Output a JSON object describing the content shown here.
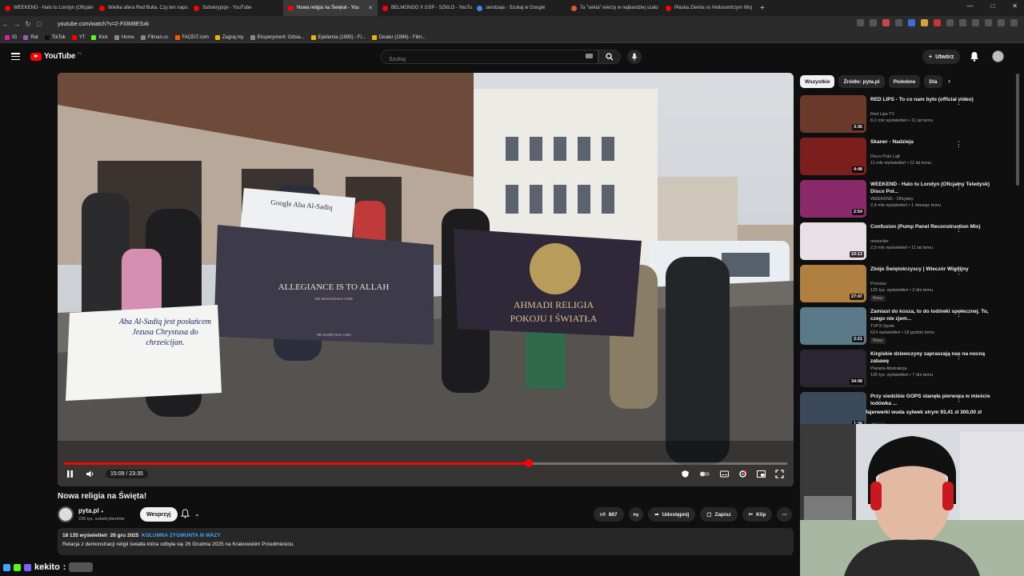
{
  "browser": {
    "tabs": [
      {
        "label": "WEEKEND - Halo tu Londyn (Oficjaln",
        "color": "#ff0000",
        "active": false
      },
      {
        "label": "Wielka afera Red Bulla. Czy ten napo",
        "color": "#ff0000",
        "active": false
      },
      {
        "label": "Subskrypcje - YouTube",
        "color": "#ff0000",
        "active": false
      },
      {
        "label": "Nowa religia na Świętal - You",
        "color": "#ff0000",
        "active": true
      },
      {
        "label": "BELMONDO X GSP - SZKŁO - YouTub",
        "color": "#ff0000",
        "active": false
      },
      {
        "label": "sendzaja - Szukaj w Google",
        "color": "#4285f4",
        "active": false
      },
      {
        "label": "Ta \"sekta\" wierzy w najbardziej szalo",
        "color": "#e2582c",
        "active": false
      },
      {
        "label": "Płaska Ziemia vs Heliocentrzym Woj",
        "color": "#ff0000",
        "active": false
      }
    ],
    "new_tab": "+",
    "url": "youtube.com/watch?v=2-FI0M8ESxk",
    "bookmarks": [
      {
        "label": "IG",
        "color": "#d6249f"
      },
      {
        "label": "Rat",
        "color": "#9b59b6"
      },
      {
        "label": "TikTok",
        "color": "#111111"
      },
      {
        "label": "YT",
        "color": "#ff0000"
      },
      {
        "label": "Kick",
        "color": "#53fc18"
      },
      {
        "label": "Home",
        "color": "#888888"
      },
      {
        "label": "Filman.cc",
        "color": "#888888"
      },
      {
        "label": "FACEIT.com",
        "color": "#ff5500"
      },
      {
        "label": "Zagraj.my",
        "color": "#e8b400"
      },
      {
        "label": "Eksperyment: Odsia...",
        "color": "#888888"
      },
      {
        "label": "Epidemia (1995) - Fi...",
        "color": "#e8b400"
      },
      {
        "label": "Dealer (1996) - Film...",
        "color": "#e8b400"
      }
    ]
  },
  "header": {
    "logo": "YouTube",
    "country": "PL",
    "search_placeholder": "Szukaj",
    "create_label": "Utwórz"
  },
  "player": {
    "time_current": "15:09",
    "time_total": "23:35",
    "time_text": "15:09 / 23:35",
    "progress": 0.643,
    "banners": {
      "google": "Google Aba Al-Sadiq",
      "allegiance": "ALLEGIANCE IS TO ALLAH",
      "allegiance_small": "THE MASSIAH HAS COME",
      "allegiance_bottom": "THE MAHDI HAS COME",
      "ahmadi_line1": "AHMADI RELIGIA",
      "ahmadi_line2": "POKOJU I ŚWIATŁA",
      "sign": "Aba Al-Sadiq jest posłańcem Jezusa Chrystusa do chrześcijan."
    }
  },
  "video": {
    "title": "Nowa religia na Święta!",
    "channel": "pyta.pl",
    "subscribers": "235 tys. subskrybentów",
    "support_label": "Wesprzyj",
    "likes": "887",
    "share_label": "Udostępnij",
    "save_label": "Zapisz",
    "clip_label": "Klip",
    "views": "18 135 wyświetleń",
    "date": "26 gru 2025",
    "location_tag": "KOLUMNA ZYGMUNTA III WAZY",
    "description": "Relacja z demonstracji religii światła która odbyła się 26 Grudnia 2025 na Krakowskim Przedmieściu."
  },
  "sidebar": {
    "chips": [
      {
        "label": "Wszystkie",
        "active": true
      },
      {
        "label": "Źródło: pyta.pl",
        "active": false
      },
      {
        "label": "Podobne",
        "active": false
      },
      {
        "label": "Dla",
        "active": false
      }
    ],
    "items": [
      {
        "title": "RED LIPS - To co nam było (official video)",
        "channel": "Red Lips TV",
        "meta": "8,2 mln wyświetleń • 11 lat temu",
        "duration": "3:36",
        "badge": "",
        "bg": "#6b3a2a"
      },
      {
        "title": "Skaner - Nadzieja",
        "channel": "Disco Polo Lajf",
        "meta": "11 mln wyświetleń • 11 lat temu",
        "duration": "4:48",
        "badge": "",
        "bg": "#7a1e1e"
      },
      {
        "title": "WEEKEND - Halo tu Londyn (Oficjalny Teledysk) Disco Pol...",
        "channel": "WEEKEND - Oficjalny",
        "meta": "2,4 mln wyświetleń • 1 miesiąc temu",
        "duration": "2:54",
        "badge": "",
        "bg": "#8b2a6a"
      },
      {
        "title": "Confusion (Pump Panel Reconstruction Mix)",
        "channel": "neworder",
        "meta": "2,5 mln wyświetleń • 11 lat temu",
        "duration": "10:13",
        "badge": "",
        "bg": "#e8e0e6"
      },
      {
        "title": "Zbóje Świętokrzyscy | Wieczór Wigilijny",
        "channel": "Pronosz",
        "meta": "125 tys. wyświetleń • 2 dni temu",
        "duration": "27:47",
        "badge": "Nowy",
        "bg": "#b08040"
      },
      {
        "title": "Zamiast do kosza, to do lodówki społecznej. To, czego nie zjem...",
        "channel": "TVP3 Opole",
        "meta": "614 wyświetleń • 18 godzin temu",
        "duration": "2:21",
        "badge": "Nowy",
        "bg": "#5a7a8a"
      },
      {
        "title": "Kirgiskie dziewczyny zapraszają nas na nocną zabawę",
        "channel": "Planeta Abstrakcja",
        "meta": "125 tys. wyświetleń • 7 dni temu",
        "duration": "34:08",
        "badge": "",
        "bg": "#2a2530"
      },
      {
        "title": "Przy siedzibie GOPS stanęła pierwsza w mieście lodówka ...",
        "channel": "",
        "meta": "",
        "duration": "1:36",
        "badge": "Nowy",
        "bg": "#3a4a5a"
      }
    ]
  },
  "stream": {
    "ticker": "fajerwerki wuda sylwek strym   93,41 zł   300,00 zł",
    "chat_name": "kekito",
    "chat_sep": ":"
  }
}
